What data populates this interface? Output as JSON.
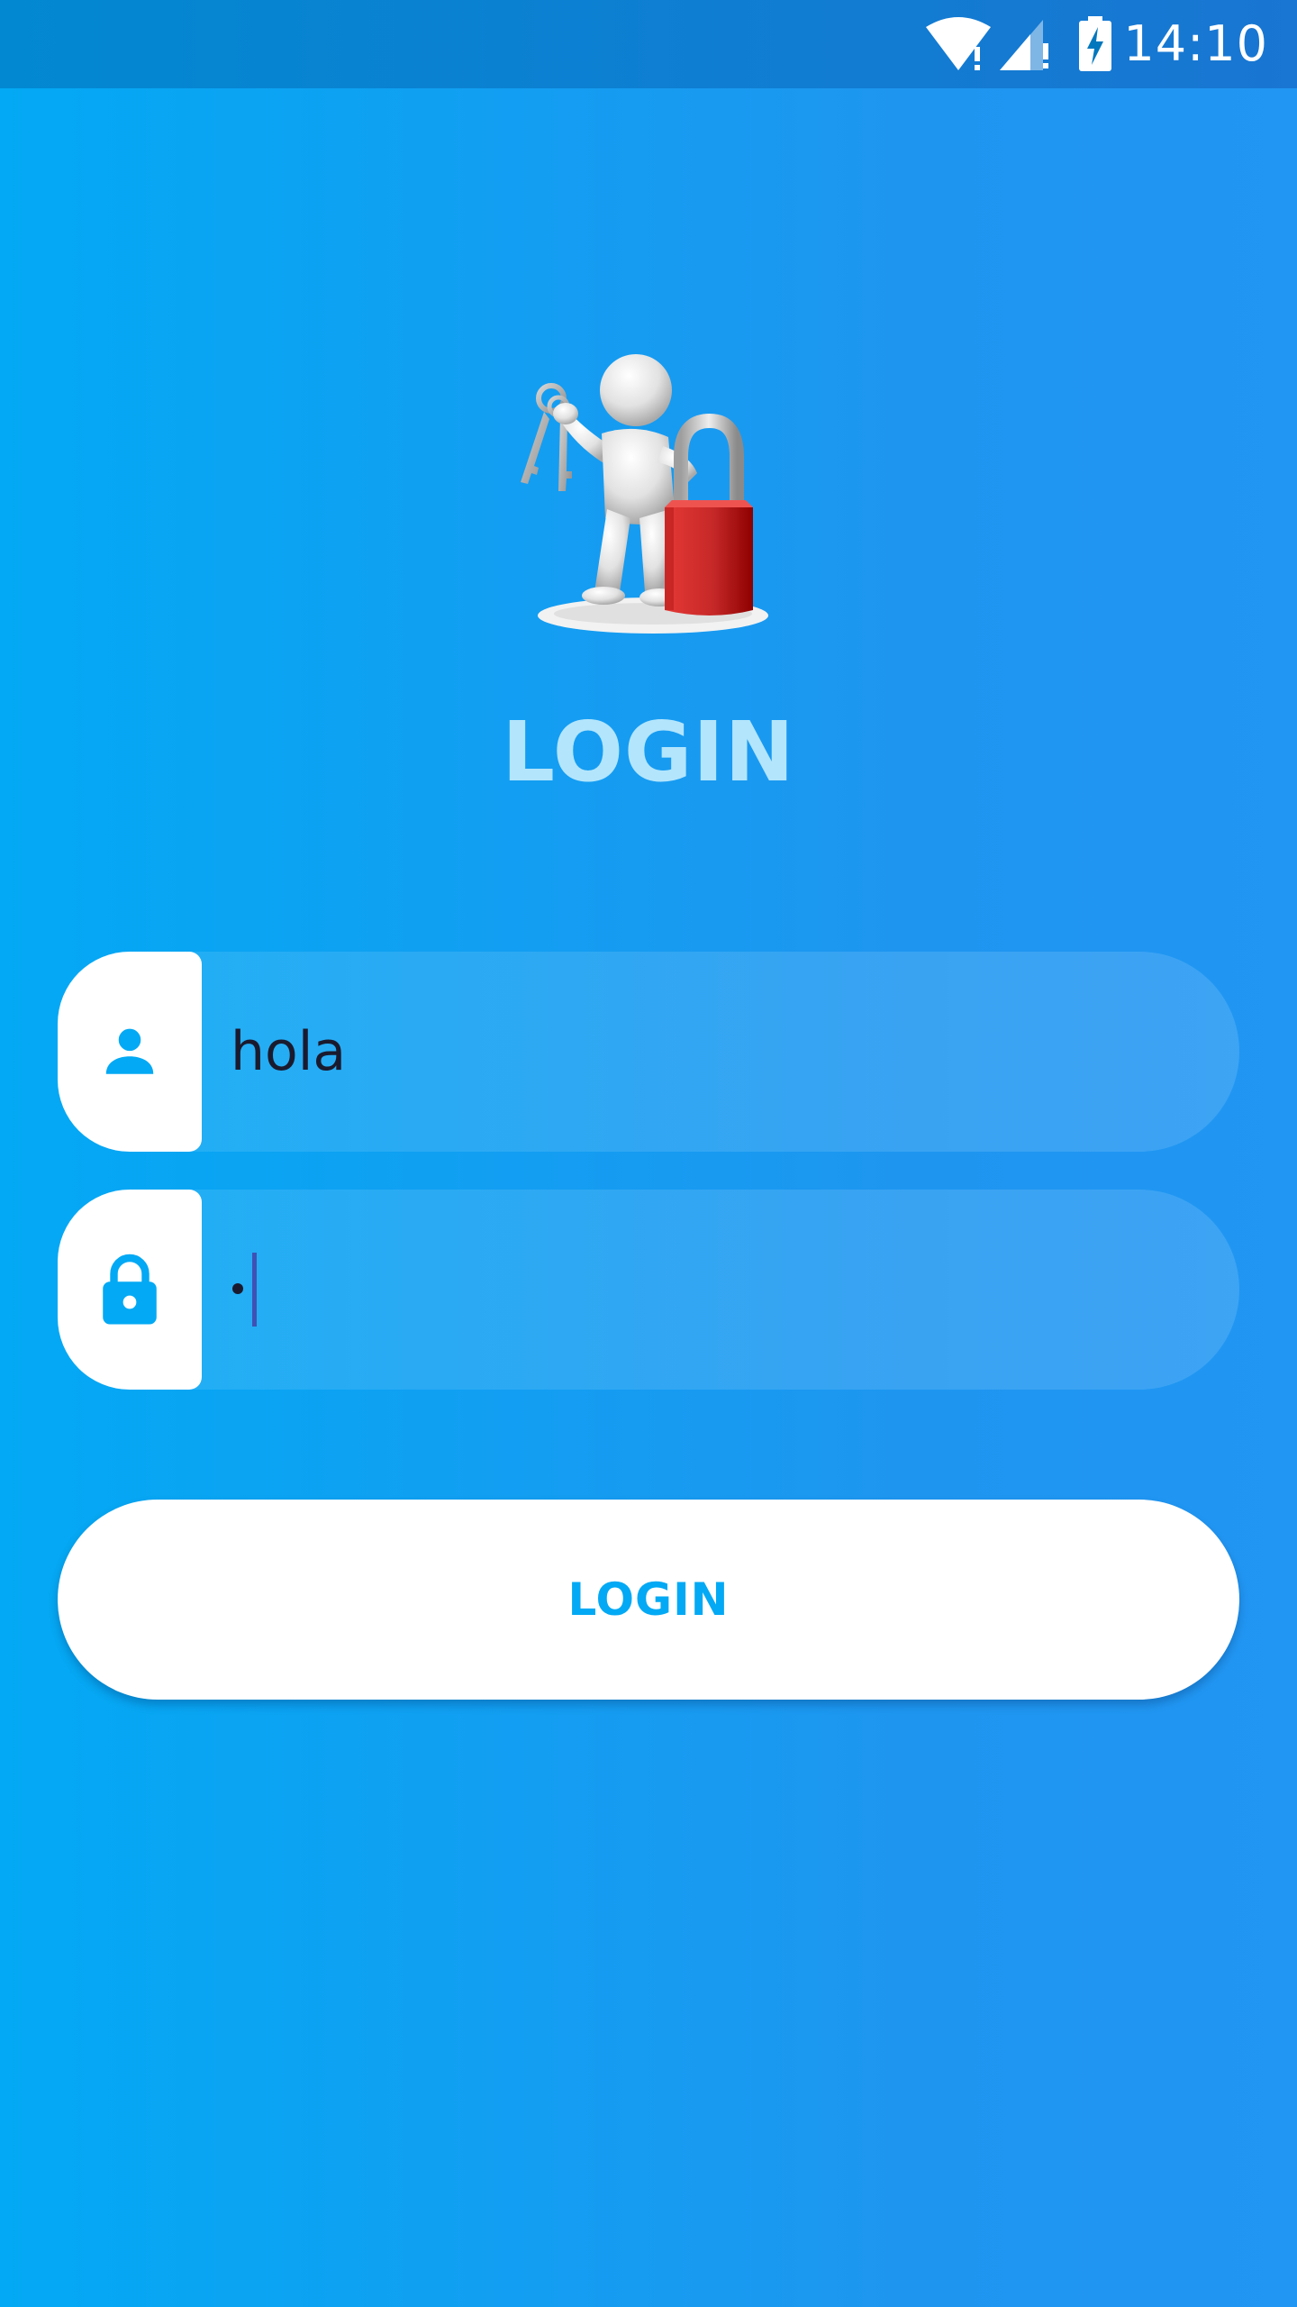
{
  "status_bar": {
    "time": "14:10",
    "icons": [
      "wifi-icon",
      "signal-icon",
      "battery-charging-icon"
    ]
  },
  "hero": {
    "illustration": "person-with-keys-and-padlock",
    "title": "LOGIN"
  },
  "form": {
    "username": {
      "icon": "person-icon",
      "value": "hola"
    },
    "password": {
      "icon": "lock-icon",
      "masked_length": 1
    },
    "submit_label": "LOGIN"
  },
  "colors": {
    "background_start": "#03A9F4",
    "background_end": "#2196F3",
    "status_bar": "#0288D1",
    "accent": "#03A9F4",
    "title": "#B3E5FC",
    "padlock": "#D32F2F"
  }
}
